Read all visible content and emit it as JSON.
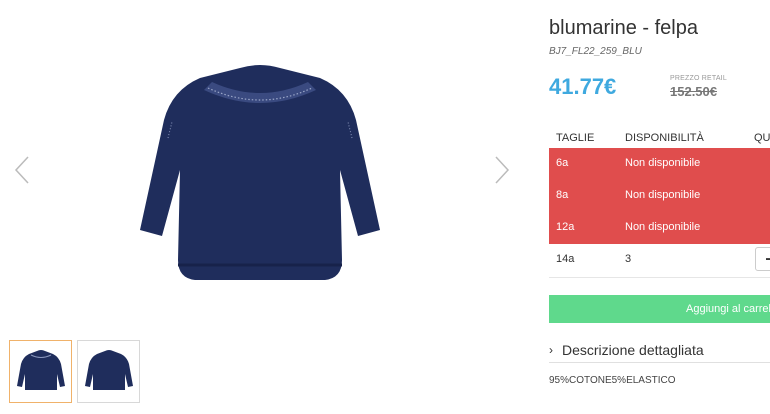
{
  "product": {
    "title": "blumarine - felpa",
    "sku": "BJ7_FL22_259_BLU",
    "price": "41.77€",
    "retail_label": "PREZZO RETAIL",
    "retail_price": "152.50€"
  },
  "sizes": {
    "headers": {
      "size": "TAGLIE",
      "availability": "DISPONIBILITÀ",
      "quantity": "QU"
    },
    "rows": [
      {
        "size": "6a",
        "availability": "Non disponibile"
      },
      {
        "size": "8a",
        "availability": "Non disponibile"
      },
      {
        "size": "12a",
        "availability": "Non disponibile"
      },
      {
        "size": "14a",
        "availability": "3",
        "qty_control": "-"
      }
    ]
  },
  "actions": {
    "add_to_cart": "Aggiungi al carrello"
  },
  "description": {
    "toggle_label": "Descrizione dettagliata",
    "chevron": "›",
    "text": "95%COTONE5%ELASTICO"
  },
  "colors": {
    "accent_price": "#3fa9df",
    "unavailable": "#e04d4d",
    "add_button": "#5fd98c",
    "garment": "#1f2d5c"
  },
  "icons": {
    "prev": "chevron-left-icon",
    "next": "chevron-right-icon"
  }
}
